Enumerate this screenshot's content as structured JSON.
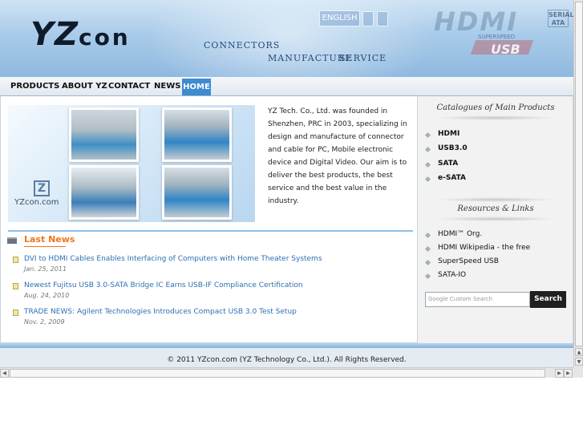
{
  "header": {
    "logo_yz": "YZ",
    "logo_con": "con",
    "link_connectors": "CONNECTORS",
    "link_manufacture": "MANUFACTURE",
    "link_service": "SERVICE",
    "lang_button": "ENGLISH",
    "hdmi_logo": "HDMI",
    "sata_logo": "SERIAL ATA",
    "usb_logo": "USB",
    "usb_logo_sub": "SUPERSPEED"
  },
  "nav": {
    "items": [
      "PRODUCTS",
      "ABOUT YZ",
      "CONTACT",
      "NEWS",
      "HOME"
    ]
  },
  "main": {
    "hero_brand": "YZcon.com",
    "hero_brand_mark": "Z",
    "intro": "YZ Tech. Co., Ltd. was founded in Shenzhen, PRC in 2003, specializing in design and manufacture of connector and cable for PC, Mobile electronic device and Digital Video. Our aim is to deliver the best products, the best service and the best value in the industry.",
    "news_title": "Last News",
    "news": [
      {
        "title": "DVI to HDMI Cables Enables Interfacing of Computers with Home Theater Systems",
        "date": "Jan. 25, 2011"
      },
      {
        "title": "Newest Fujitsu USB 3.0-SATA Bridge IC Earns USB-IF Compliance Certification",
        "date": "Aug. 24, 2010"
      },
      {
        "title": "TRADE NEWS: Agilent Technologies Introduces Compact USB 3.0 Test Setup",
        "date": "Nov. 2, 2009"
      }
    ]
  },
  "sidebar": {
    "catalog_title": "Catalogues of Main Products",
    "products": [
      "HDMI",
      "USB3.0",
      "SATA",
      "e-SATA"
    ],
    "resources_title": "Resources  &  Links",
    "links": [
      "HDMI™ Org.",
      "HDMI Wikipedia - the free",
      "SuperSpeed USB",
      "SATA-IO"
    ],
    "search_placeholder": "Google Custom Search",
    "search_button": "Search"
  },
  "footer": {
    "copyright": "© 2011 YZcon.com (YZ Technology Co., Ltd.). All Rights Reserved."
  },
  "colors": {
    "accent": "#3d8bd0",
    "news_orange": "#f0761c",
    "link_blue": "#2c6fb3"
  },
  "icons": [
    "news-icon",
    "bullet-icon",
    "diamond-icon",
    "scroll-arrow-icon"
  ]
}
